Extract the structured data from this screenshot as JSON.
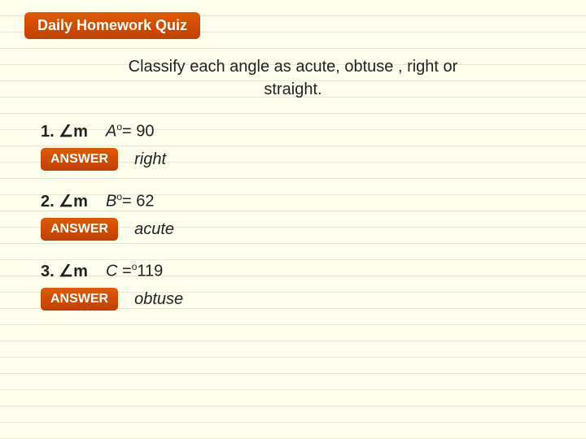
{
  "title": "Daily Homework Quiz",
  "header": {
    "line1": "Classify each angle as acute, obtuse , right or",
    "line2": "straight."
  },
  "questions": [
    {
      "number": "1.",
      "angle_label": "∠m",
      "formula": "A°= 90",
      "formula_display": "A<sup>o</sup>= 90",
      "answer_label": "ANSWER",
      "answer": "right"
    },
    {
      "number": "2.",
      "angle_label": "∠m",
      "formula": "B°= 62",
      "formula_display": "B<sup>o</sup>= 62",
      "answer_label": "ANSWER",
      "answer": "acute"
    },
    {
      "number": "3.",
      "angle_label": "∠m",
      "formula": "C °119",
      "formula_display": "C =<sup>o</sup>119",
      "answer_label": "ANSWER",
      "answer": "obtuse"
    }
  ]
}
